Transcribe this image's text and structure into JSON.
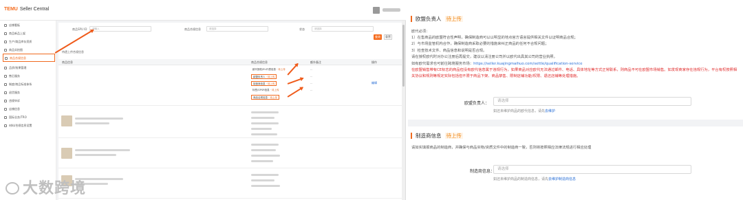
{
  "app": {
    "brand": "TEMU",
    "brand_sub": "Seller Central"
  },
  "sidebar": {
    "items": [
      {
        "label": "店铺看板"
      },
      {
        "label": "商品新品上架"
      },
      {
        "label": "生产/商品库存资质"
      },
      {
        "label": "商品实拍图"
      },
      {
        "label": "商品合规信息"
      },
      {
        "label": "品质/效果管理"
      },
      {
        "label": "售后服务"
      },
      {
        "label": "制度/商品标准体系"
      },
      {
        "label": "退货服务"
      },
      {
        "label": "违规申诉"
      },
      {
        "label": "店铺信息"
      },
      {
        "label": "国际业务/TRO"
      },
      {
        "label": "材料/合规信息设置"
      }
    ]
  },
  "filters": {
    "spu_label": "商品SPU ID",
    "spu_placeholder": "请输入",
    "attr_label": "商品合规信息",
    "attr_placeholder": "请选择",
    "status_label": "状态",
    "status_placeholder": "请选择",
    "query_button": "查询",
    "reset_button": "重置"
  },
  "table": {
    "title": "待遗上传合规信息",
    "headers": [
      "商品信息",
      "商品合规信息",
      "额外备注",
      "操作"
    ],
    "rows": [
      {
        "attrs": [
          {
            "name": "欧代授权/EU代表信息",
            "status": "待上传",
            "boxed": false
          },
          {
            "name": "欧盟负责人",
            "status": "待上传",
            "boxed": true
          },
          {
            "name": "制造商信息",
            "status": "待上传",
            "boxed": true
          },
          {
            "name": "标签/GPSR信息",
            "status": "待上传",
            "boxed": false
          },
          {
            "name": "商品合规信息",
            "status": "待上传",
            "boxed": true
          }
        ],
        "op": "编辑"
      }
    ]
  },
  "form": {
    "eu_section": {
      "title": "欧盟负责人",
      "status": "待上传",
      "intro": "欧代必须：",
      "lines": [
        "1）在售商品的欧盟符合性声明，确保制造商可以以明显的地点官方语言提供相关文件以证明商品合规；",
        "2）与市场监管机构合作，确保制造商采取必要的措施来纠正商品的任何不合规问题；",
        "3）检查技术文件、商品信息和说明是否合规。",
        "请在授权欧代时对办公注册后再提交，建议以清注册公司并以欧代出具其公司的营业执照。"
      ],
      "link_prefix": "如有欧代需求也可前往跨境服务市场：",
      "link_text": "https://seller.kuajingmaihuo.com/settle/qualification-service",
      "warning": "在欧盟销售带有CE标志的商品但没有欧代信息属于违规行为，如果商品对应欧代无法通过邮件、电话、具体地址等方式正常联系，则商品不可在欧盟市场销售。如发现商家存在违规行为，平台有权按照相关协议和规则等规定实际包括但不限于商品下架、商品禁售、限制店铺功能/权限、退还店铺等处理措施。",
      "field_label": "欧盟负责人：",
      "field_placeholder": "请选择",
      "hint_prefix": "如还未维护商品的欧代信息，请先",
      "hint_link": "去维护"
    },
    "mfr_section": {
      "title": "制造商信息",
      "status": "待上传",
      "desc": "请如实填报商品的制造商，并确保与商品实物/资质文件中的制造商一致，否则将按照相应法律法规进行相应处理",
      "field_label": "制造商信息：",
      "field_placeholder": "请选择",
      "hint_prefix": "如还未维护商品的制造商信息，请先",
      "hint_link": "去维护制造商信息"
    }
  },
  "watermark": "大数跨境",
  "colors": {
    "accent": "#f06a1e",
    "link": "#2a6fd6",
    "warning": "#e02828"
  }
}
